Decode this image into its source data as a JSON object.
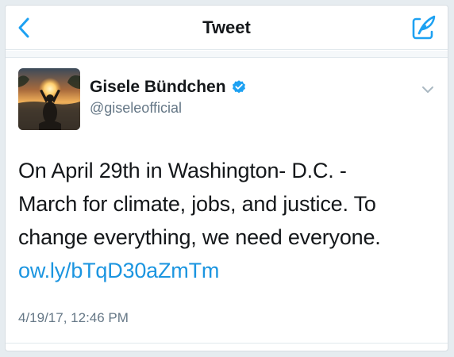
{
  "navbar": {
    "title": "Tweet",
    "back_icon": "chevron-left-icon",
    "compose_icon": "compose-tweet-icon",
    "accent_color": "#1da1f2"
  },
  "tweet": {
    "author": {
      "display_name": "Gisele Bündchen",
      "handle": "@giseleofficial",
      "verified": true,
      "verified_icon": "verified-badge-icon"
    },
    "caret_icon": "chevron-down-icon",
    "text_lines": [
      "On April 29th in Washington- D.C. -",
      "March for climate, jobs, and justice. To",
      "change everything, we need everyone."
    ],
    "link": "ow.ly/bTqD30aZmTm",
    "timestamp": "4/19/17, 12:46 PM",
    "colors": {
      "text": "#14171a",
      "secondary": "#657786",
      "link": "#1b95e0"
    }
  }
}
